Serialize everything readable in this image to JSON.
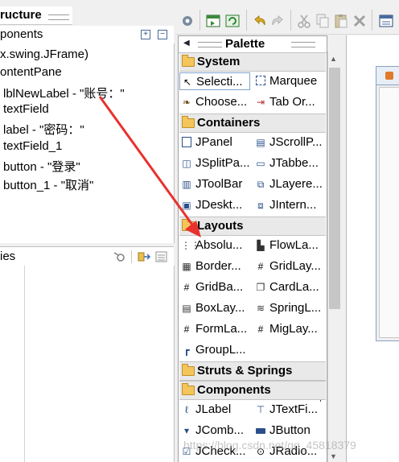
{
  "structure_panel": {
    "title": "ructure",
    "components_label": "ponents",
    "expand_button": "+",
    "collapse_button": "−",
    "tree": [
      {
        "text": "x.swing.JFrame)"
      },
      {
        "text": "ontentPane"
      },
      {
        "text": "lblNewLabel - \"账号：\""
      },
      {
        "text": "textField"
      },
      {
        "text": "label - \"密码：\""
      },
      {
        "text": "textField_1"
      },
      {
        "text": "button - \"登录\""
      },
      {
        "text": "button_1 - \"取消\""
      }
    ]
  },
  "properties_panel": {
    "title": "ies"
  },
  "palette": {
    "title": "Palette",
    "categories": {
      "system": "System",
      "containers": "Containers",
      "layouts": "Layouts",
      "struts": "Struts & Springs",
      "components": "Components"
    },
    "items": {
      "selection": "Selecti...",
      "marquee": "Marquee",
      "choose": "Choose...",
      "taborder": "Tab Or...",
      "jpanel": "JPanel",
      "jscrollpane": "JScrollP...",
      "jsplitpane": "JSplitPa...",
      "jtabbedpane": "JTabbe...",
      "jtoolbar": "JToolBar",
      "jlayeredpane": "JLayere...",
      "jdesktoppane": "JDeskt...",
      "jinternalframe": "JIntern...",
      "absolute": "Absolu...",
      "flowlayout": "FlowLa...",
      "borderlayout": "Border...",
      "gridlayout": "GridLay...",
      "gridbaglayout": "GridBa...",
      "cardlayout": "CardLa...",
      "boxlayout": "BoxLay...",
      "springlayout": "SpringL...",
      "formlayout": "FormLa...",
      "miglayout": "MigLay...",
      "grouplayout": "GroupL...",
      "jlabel": "JLabel",
      "jtextfield": "JTextFi...",
      "jcombobox": "JComb...",
      "jbutton": "JButton",
      "jcheckbox": "JCheck...",
      "jradiobutton": "JRadio..."
    }
  },
  "watermark": "https://blog.csdn.net/qq_45818379",
  "colors": {
    "arrow": "#e8322e",
    "folder": "#f4c55a",
    "selection_border": "#7da2ce"
  }
}
